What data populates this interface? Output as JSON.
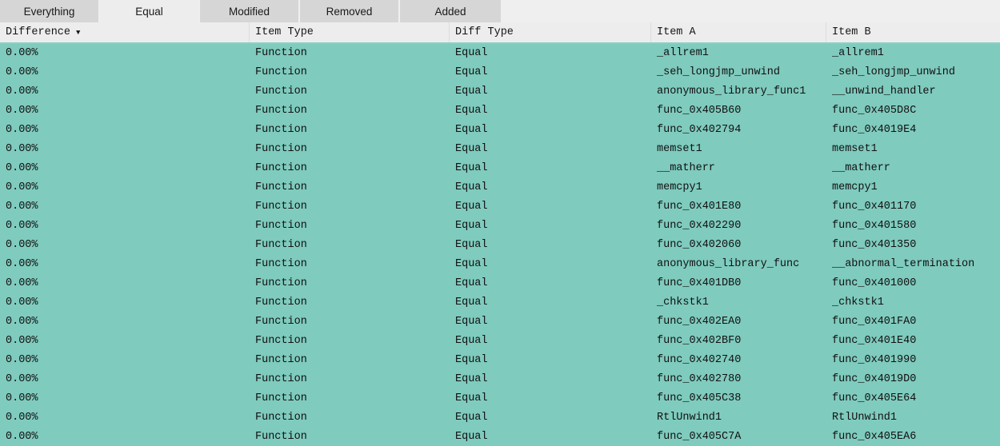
{
  "colors": {
    "row_background": "#7fcbbe",
    "header_background": "#ededed",
    "header_accent": "#8ccfc2",
    "tab_inactive": "#d6d6d6",
    "tab_selected": "#ededed",
    "text": "#111111"
  },
  "tabs": [
    {
      "label": "Everything",
      "selected": false
    },
    {
      "label": "Equal",
      "selected": true
    },
    {
      "label": "Modified",
      "selected": false
    },
    {
      "label": "Removed",
      "selected": false
    },
    {
      "label": "Added",
      "selected": false
    }
  ],
  "columns": [
    {
      "label": "Difference",
      "sorted": true,
      "sort_direction": "descending",
      "sort_icon": "triangle-down-icon"
    },
    {
      "label": "Item Type",
      "sorted": false
    },
    {
      "label": "Diff Type",
      "sorted": false
    },
    {
      "label": "Item A",
      "sorted": false
    },
    {
      "label": "Item B",
      "sorted": false
    }
  ],
  "rows": [
    {
      "difference": "0.00%",
      "item_type": "Function",
      "diff_type": "Equal",
      "item_a": "_allrem1",
      "item_b": "_allrem1"
    },
    {
      "difference": "0.00%",
      "item_type": "Function",
      "diff_type": "Equal",
      "item_a": "_seh_longjmp_unwind",
      "item_b": "_seh_longjmp_unwind"
    },
    {
      "difference": "0.00%",
      "item_type": "Function",
      "diff_type": "Equal",
      "item_a": "anonymous_library_func1",
      "item_b": "__unwind_handler"
    },
    {
      "difference": "0.00%",
      "item_type": "Function",
      "diff_type": "Equal",
      "item_a": "func_0x405B60",
      "item_b": "func_0x405D8C"
    },
    {
      "difference": "0.00%",
      "item_type": "Function",
      "diff_type": "Equal",
      "item_a": "func_0x402794",
      "item_b": "func_0x4019E4"
    },
    {
      "difference": "0.00%",
      "item_type": "Function",
      "diff_type": "Equal",
      "item_a": "memset1",
      "item_b": "memset1"
    },
    {
      "difference": "0.00%",
      "item_type": "Function",
      "diff_type": "Equal",
      "item_a": "__matherr",
      "item_b": "__matherr"
    },
    {
      "difference": "0.00%",
      "item_type": "Function",
      "diff_type": "Equal",
      "item_a": "memcpy1",
      "item_b": "memcpy1"
    },
    {
      "difference": "0.00%",
      "item_type": "Function",
      "diff_type": "Equal",
      "item_a": "func_0x401E80",
      "item_b": "func_0x401170"
    },
    {
      "difference": "0.00%",
      "item_type": "Function",
      "diff_type": "Equal",
      "item_a": "func_0x402290",
      "item_b": "func_0x401580"
    },
    {
      "difference": "0.00%",
      "item_type": "Function",
      "diff_type": "Equal",
      "item_a": "func_0x402060",
      "item_b": "func_0x401350"
    },
    {
      "difference": "0.00%",
      "item_type": "Function",
      "diff_type": "Equal",
      "item_a": "anonymous_library_func",
      "item_b": "__abnormal_termination"
    },
    {
      "difference": "0.00%",
      "item_type": "Function",
      "diff_type": "Equal",
      "item_a": "func_0x401DB0",
      "item_b": "func_0x401000"
    },
    {
      "difference": "0.00%",
      "item_type": "Function",
      "diff_type": "Equal",
      "item_a": "_chkstk1",
      "item_b": "_chkstk1"
    },
    {
      "difference": "0.00%",
      "item_type": "Function",
      "diff_type": "Equal",
      "item_a": "func_0x402EA0",
      "item_b": "func_0x401FA0"
    },
    {
      "difference": "0.00%",
      "item_type": "Function",
      "diff_type": "Equal",
      "item_a": "func_0x402BF0",
      "item_b": "func_0x401E40"
    },
    {
      "difference": "0.00%",
      "item_type": "Function",
      "diff_type": "Equal",
      "item_a": "func_0x402740",
      "item_b": "func_0x401990"
    },
    {
      "difference": "0.00%",
      "item_type": "Function",
      "diff_type": "Equal",
      "item_a": "func_0x402780",
      "item_b": "func_0x4019D0"
    },
    {
      "difference": "0.00%",
      "item_type": "Function",
      "diff_type": "Equal",
      "item_a": "func_0x405C38",
      "item_b": "func_0x405E64"
    },
    {
      "difference": "0.00%",
      "item_type": "Function",
      "diff_type": "Equal",
      "item_a": "RtlUnwind1",
      "item_b": "RtlUnwind1"
    },
    {
      "difference": "0.00%",
      "item_type": "Function",
      "diff_type": "Equal",
      "item_a": "func_0x405C7A",
      "item_b": "func_0x405EA6"
    }
  ]
}
